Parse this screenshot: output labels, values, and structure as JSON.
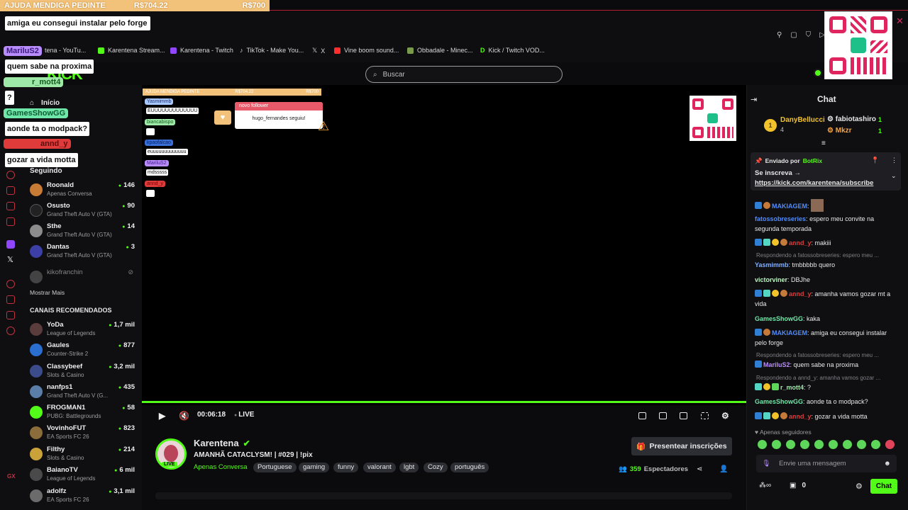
{
  "donation_bar": {
    "title": "AJUDA MENDIGA PEDINTE",
    "current": "R$704.22",
    "goal": "R$700"
  },
  "overlay_chat": [
    {
      "name": "",
      "msg": "amiga eu consegui instalar pelo forge"
    },
    {
      "name": "MariluS2",
      "msg": "quem sabe na proxima"
    },
    {
      "name": "r_mott4",
      "msg": "?"
    },
    {
      "name": "GamesShowGG",
      "msg": "aonde ta o modpack?"
    },
    {
      "name": "annd_y",
      "msg": "gozar a vida motta"
    }
  ],
  "bookmarks": [
    "tena - YouTu...",
    "Karentena Stream...",
    "Karentena - Twitch",
    "TikTok - Make You...",
    "X",
    "Vine boom sound...",
    "Obbadale - Minec...",
    "Kick / Twitch VOD..."
  ],
  "search": {
    "placeholder": "Buscar"
  },
  "sidebar": {
    "home": "Início",
    "following_title": "Seguindo",
    "following": [
      {
        "name": "Roonald",
        "game": "Apenas Conversa",
        "viewers": "146"
      },
      {
        "name": "Osusto",
        "game": "Grand Theft Auto V (GTA)",
        "viewers": "90"
      },
      {
        "name": "Sthe",
        "game": "Grand Theft Auto V (GTA)",
        "viewers": "14"
      },
      {
        "name": "Dantas",
        "game": "Grand Theft Auto V (GTA)",
        "viewers": "3"
      },
      {
        "name": "kikofranchin",
        "game": "",
        "viewers": ""
      }
    ],
    "show_more": "Mostrar Mais",
    "recommended_title": "CANAIS RECOMENDADOS",
    "recommended": [
      {
        "name": "YoDa",
        "game": "League of Legends",
        "viewers": "1,7 mil"
      },
      {
        "name": "Gaules",
        "game": "Counter-Strike 2",
        "viewers": "877"
      },
      {
        "name": "Classybeef",
        "game": "Slots & Casino",
        "viewers": "3,2 mil"
      },
      {
        "name": "nanfps1",
        "game": "Grand Theft Auto V (G...",
        "viewers": "435"
      },
      {
        "name": "FROGMAN1",
        "game": "PUBG: Battlegrounds",
        "viewers": "58"
      },
      {
        "name": "VovinhoFUT",
        "game": "EA Sports FC 26",
        "viewers": "823"
      },
      {
        "name": "Filthy",
        "game": "Slots & Casino",
        "viewers": "214"
      },
      {
        "name": "BaianoTV",
        "game": "League of Legends",
        "viewers": "6 mil"
      },
      {
        "name": "adolfz",
        "game": "EA Sports FC 26",
        "viewers": "3,1 mil"
      }
    ]
  },
  "player": {
    "time": "00:06:18",
    "live_label": "LIVE",
    "mini_overlay": {
      "bar_title": "AJUDA MENDIGA PEDINTE",
      "bar_current": "R$704.22",
      "bar_goal": "R$700",
      "follower_title": "novo follower",
      "follower_text": "hugo_fernandes seguiu!",
      "chat": [
        {
          "name": "Yasmimmb",
          "msg": "EUUUUUUUUUUUUU"
        },
        {
          "name": "biancabispo",
          "msg": ""
        },
        {
          "name": "kpaofalcao",
          "msg": "euuuuuuuuuuuuu"
        },
        {
          "name": "MariluS2",
          "msg": "mdsssss"
        },
        {
          "name": "annd_y",
          "msg": ""
        }
      ]
    }
  },
  "stream": {
    "channel": "Karentena",
    "live_badge": "LIVE",
    "title": "AMANHÃ CATACLYSM! | #029 | !pix",
    "category": "Apenas Conversa",
    "tags": [
      "Portuguese",
      "gaming",
      "funny",
      "valorant",
      "lgbt",
      "Cozy",
      "português"
    ],
    "subscribe_button": "Presentear inscrições",
    "viewers": "359",
    "viewers_label": "Espectadores"
  },
  "chat": {
    "title": "Chat",
    "leaderboard": [
      {
        "name": "DanyBellucci",
        "value": "4"
      },
      {
        "name": "fabiotashiro",
        "value": "1"
      },
      {
        "name": "Mkzr",
        "value": "1"
      }
    ],
    "pinned": {
      "sent_by_label": "Enviado por",
      "sender": "BotRix",
      "text": "Se inscreva →",
      "link": "https://kick.com/karentena/subscribe"
    },
    "messages": [
      {
        "user": "MAKIAGEM",
        "text": "",
        "color": "#4f8cff",
        "reply": ""
      },
      {
        "user": "fatossobreseries",
        "text": "espero meu convite na segunda temporada",
        "color": "#4f8cff",
        "reply": ""
      },
      {
        "user": "annd_y",
        "text": "makiii",
        "color": "#e03b3b",
        "reply": ""
      },
      {
        "user": "Yasmimmb",
        "text": "tmbbbbb quero",
        "color": "#7fb0ff",
        "reply": "Respondendo a fatossobreseries: espero meu ..."
      },
      {
        "user": "victorviner",
        "text": "DBJhe",
        "color": "#b9f6c0",
        "reply": ""
      },
      {
        "user": "annd_y",
        "text": "amanha vamos gozar mt a vida",
        "color": "#e03b3b",
        "reply": ""
      },
      {
        "user": "GamesShowGG",
        "text": "kaka",
        "color": "#6ee7a8",
        "reply": ""
      },
      {
        "user": "MAKIAGEM",
        "text": "amiga eu consegui instalar pelo forge",
        "color": "#4f8cff",
        "reply": ""
      },
      {
        "user": "MariluS2",
        "text": "quem sabe na proxima",
        "color": "#b98cff",
        "reply": "Respondendo a fatossobreseries: espero meu ..."
      },
      {
        "user": "r_mott4",
        "text": "?",
        "color": "#9fe9a8",
        "reply": "Respondendo a annd_y: amanha vamos gozar ..."
      },
      {
        "user": "GamesShowGG",
        "text": "aonde ta o modpack?",
        "color": "#6ee7a8",
        "reply": ""
      },
      {
        "user": "annd_y",
        "text": "gozar a vida motta",
        "color": "#e03b3b",
        "reply": ""
      }
    ],
    "followers_only": "Apenas seguidores",
    "input_placeholder": "Envie uma mensagem",
    "points": "0",
    "send_button": "Chat"
  }
}
